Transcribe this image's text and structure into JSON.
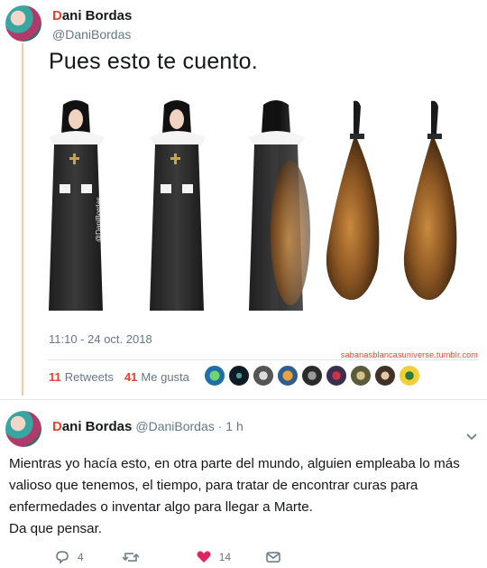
{
  "tweet": {
    "display_name_first": "D",
    "display_name_rest": "ani Bordas",
    "handle": "@DaniBordas",
    "text": "Pues esto te cuento.",
    "media_watermark": "@DaniBordas",
    "timestamp": "11:10 - 24 oct. 2018",
    "source_watermark": "sabanasblancasuniverse.tumblr.com",
    "retweets_count": "11",
    "retweets_label": "Retweets",
    "likes_count": "41",
    "likes_label": "Me gusta"
  },
  "reply": {
    "display_name_first": "D",
    "display_name_rest": "ani Bordas",
    "handle": "@DaniBordas",
    "time": "· 1 h",
    "lines": [
      "Mientras yo hacía esto, en otra parte del mundo, alguien empleaba lo más",
      "valioso que tenemos, el tiempo, para tratar de encontrar curas para",
      "enfermedades o inventar algo para llegar a Marte.",
      "Da que pensar."
    ],
    "reply_count": "4",
    "like_count": "14"
  },
  "colors": {
    "accent": "#e8412c",
    "thread": "#f7c7a4",
    "muted": "#657786",
    "like": "#e0245e"
  },
  "icons": [
    "reply-icon",
    "retweet-icon",
    "heart-icon",
    "message-icon",
    "chevron-down-icon"
  ]
}
